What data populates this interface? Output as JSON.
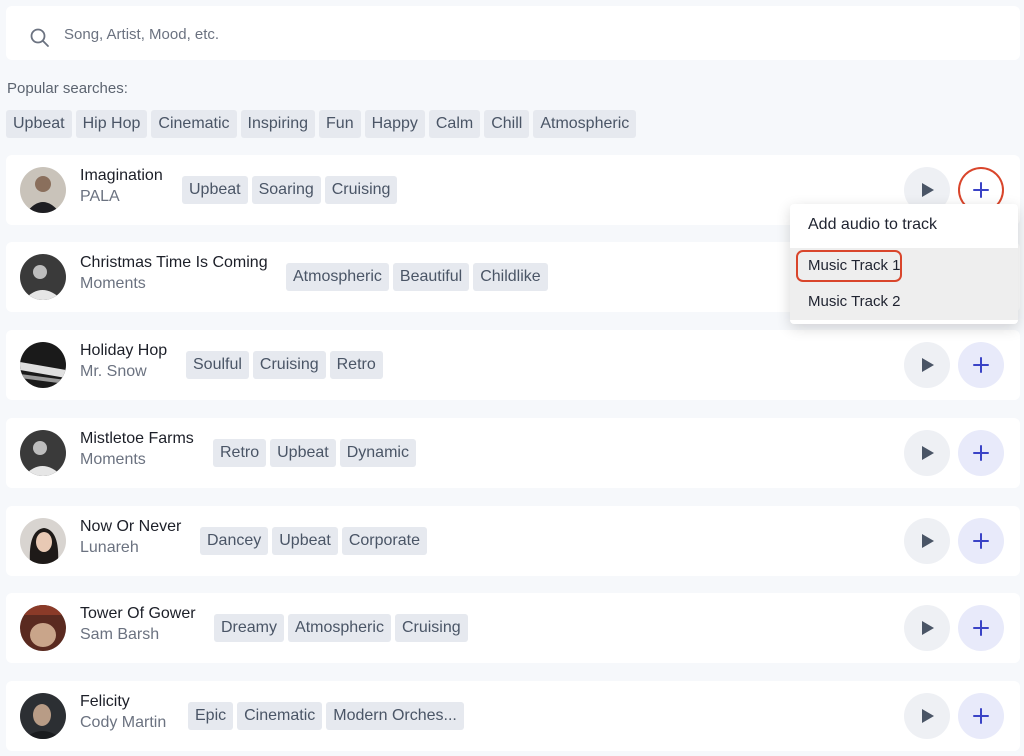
{
  "search": {
    "placeholder": "Song, Artist, Mood, etc.",
    "value": ""
  },
  "popular": {
    "label": "Popular searches:",
    "chips": [
      "Upbeat",
      "Hip Hop",
      "Cinematic",
      "Inspiring",
      "Fun",
      "Happy",
      "Calm",
      "Chill",
      "Atmospheric"
    ]
  },
  "tracks": [
    {
      "title": "Imagination",
      "artist": "PALA",
      "tags": [
        "Upbeat",
        "Soaring",
        "Cruising"
      ]
    },
    {
      "title": "Christmas Time Is Coming",
      "artist": "Moments",
      "tags": [
        "Atmospheric",
        "Beautiful",
        "Childlike"
      ]
    },
    {
      "title": "Holiday Hop",
      "artist": "Mr. Snow",
      "tags": [
        "Soulful",
        "Cruising",
        "Retro"
      ]
    },
    {
      "title": "Mistletoe Farms",
      "artist": "Moments",
      "tags": [
        "Retro",
        "Upbeat",
        "Dynamic"
      ]
    },
    {
      "title": "Now Or Never",
      "artist": "Lunareh",
      "tags": [
        "Dancey",
        "Upbeat",
        "Corporate"
      ]
    },
    {
      "title": "Tower Of Gower",
      "artist": "Sam Barsh",
      "tags": [
        "Dreamy",
        "Atmospheric",
        "Cruising"
      ]
    },
    {
      "title": "Felicity",
      "artist": "Cody Martin",
      "tags": [
        "Epic",
        "Cinematic",
        "Modern Orches..."
      ]
    }
  ],
  "dropdown": {
    "header": "Add audio to track",
    "items": [
      "Music Track 1",
      "Music Track 2"
    ]
  },
  "icons": {
    "search": "search-icon",
    "play": "play-icon",
    "add": "plus-icon"
  },
  "colors": {
    "accent": "#3a43c6",
    "highlight_ring": "#d9452b",
    "tag_bg": "#e6e9ef"
  }
}
